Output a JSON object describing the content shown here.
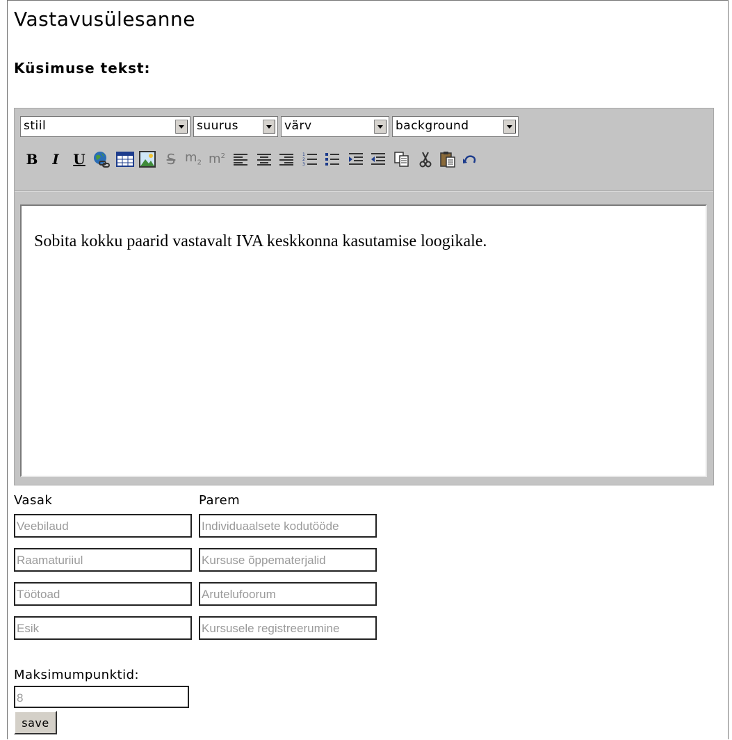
{
  "page": {
    "title": "Vastavusülesanne",
    "question_label": "Küsimuse tekst:"
  },
  "editor": {
    "selects": {
      "style": "stiil",
      "size": "suurus",
      "color": "värv",
      "background": "background"
    },
    "toolbar_icons": [
      "bold-icon",
      "italic-icon",
      "underline-icon",
      "link-icon",
      "table-icon",
      "image-icon",
      "strikethrough-icon",
      "subscript-icon",
      "superscript-icon",
      "align-left-icon",
      "align-center-icon",
      "align-right-icon",
      "ordered-list-icon",
      "unordered-list-icon",
      "indent-icon",
      "outdent-icon",
      "copy-icon",
      "cut-icon",
      "paste-icon",
      "undo-icon"
    ],
    "content": "Sobita kokku paarid vastavalt IVA keskkonna kasutamise loogikale."
  },
  "pairs": {
    "left_header": "Vasak",
    "right_header": "Parem",
    "rows": [
      {
        "left": "Veebilaud",
        "right": "Individuaalsete kodutööde"
      },
      {
        "left": "Raamaturiiul",
        "right": "Kursuse õppematerjalid"
      },
      {
        "left": "Töötoad",
        "right": "Arutelufoorum"
      },
      {
        "left": "Esik",
        "right": "Kursusele registreerumine"
      }
    ]
  },
  "max_points": {
    "label": "Maksimumpunktid:",
    "value": "8"
  },
  "save_label": "save"
}
